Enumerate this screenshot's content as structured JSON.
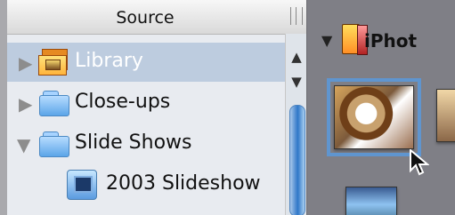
{
  "sidebar": {
    "header": "Source",
    "items": [
      {
        "label": "Library",
        "icon": "library-icon",
        "disclosure": "closed",
        "selected": true
      },
      {
        "label": "Close-ups",
        "icon": "folder-icon",
        "disclosure": "closed",
        "selected": false
      },
      {
        "label": "Slide Shows",
        "icon": "folder-icon",
        "disclosure": "open",
        "selected": false
      },
      {
        "label": "2003 Slideshow",
        "icon": "slideshow-icon",
        "disclosure": "",
        "selected": false
      }
    ]
  },
  "content": {
    "album_title": "iPhot",
    "selected_photo": "dog-photo"
  },
  "colors": {
    "selection": "#bdccdf",
    "selected_text": "#ffffff",
    "content_background": "#7f7f86"
  }
}
